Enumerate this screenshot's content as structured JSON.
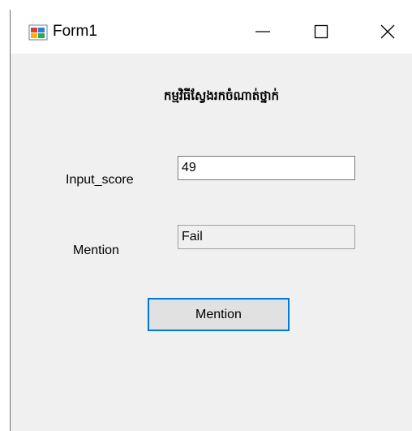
{
  "window": {
    "title": "Form1",
    "icon": "winforms-app-icon",
    "controls": {
      "minimize": "minimize-icon",
      "maximize": "maximize-icon",
      "close": "close-icon"
    }
  },
  "form": {
    "heading": "កម្មវិធីស្វែងរកចំណាត់ថ្នាក់",
    "input_label": "Input_score",
    "input_value": "49",
    "mention_label": "Mention",
    "mention_value": "Fail",
    "button_label": "Mention"
  },
  "colors": {
    "form_background": "#f0f0f0",
    "button_focus_border": "#0078d7"
  }
}
